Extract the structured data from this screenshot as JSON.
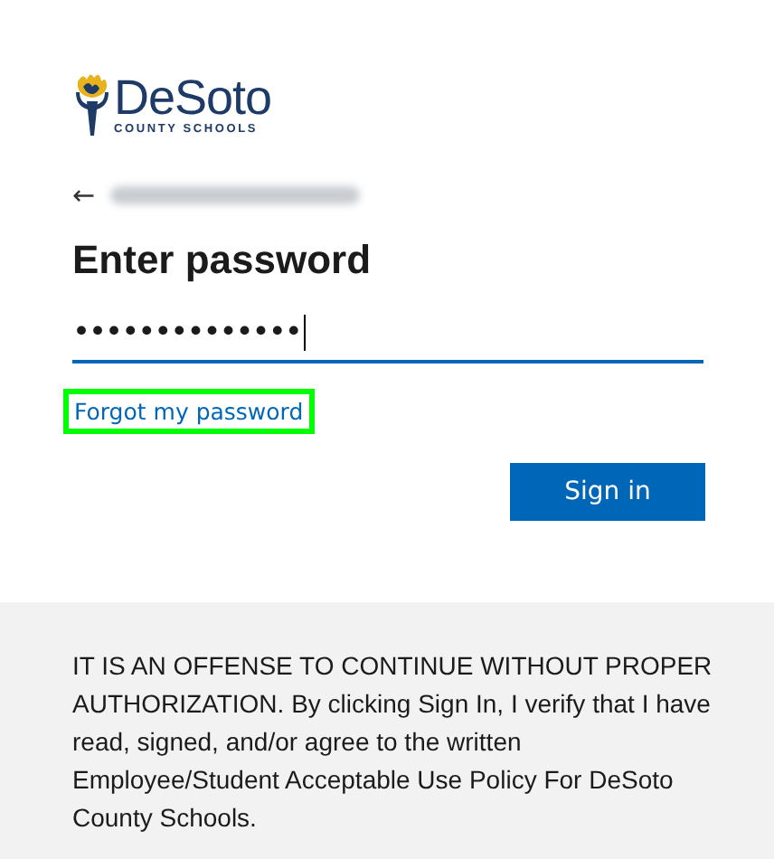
{
  "logo": {
    "name": "DeSoto",
    "subtitle": "COUNTY SCHOOLS"
  },
  "account": {
    "back_icon": "←",
    "email_redacted": true
  },
  "heading": "Enter password",
  "password": {
    "value": "••••••••••••••",
    "focused": true
  },
  "forgot_link": {
    "label": "Forgot my password",
    "highlighted": true
  },
  "buttons": [
    {
      "label": "Sign in",
      "kind": "primary"
    }
  ],
  "notice": "IT IS AN OFFENSE TO CONTINUE WITHOUT PROPER AUTHORIZATION. By clicking Sign In, I verify that I have read, signed, and/or agree to the written Employee/Student Acceptable Use Policy For DeSoto County Schools."
}
